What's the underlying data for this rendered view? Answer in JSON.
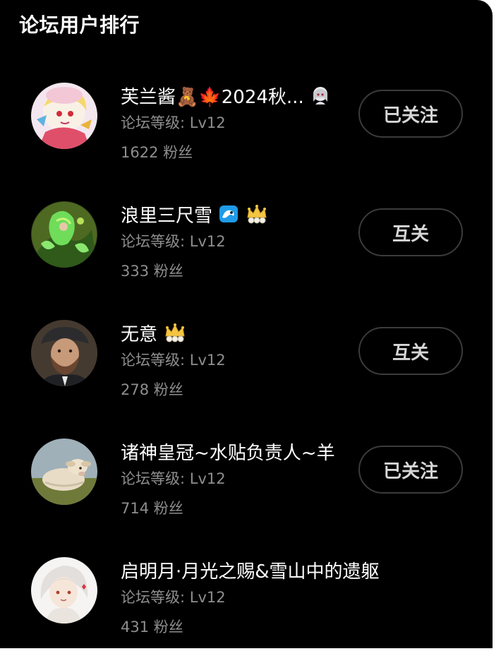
{
  "header": {
    "title": "论坛用户排行"
  },
  "users": [
    {
      "name": "芙兰酱🧸🍁2024秋...",
      "level_label": "论坛等级: Lv12",
      "fans_label": "1622 粉丝",
      "follow_label": "已关注",
      "badges": [
        "bear-emoji-icon",
        "maple-leaf-icon",
        "anime-girl-badge-icon"
      ]
    },
    {
      "name": "浪里三尺雪",
      "level_label": "论坛等级: Lv12",
      "fans_label": "333 粉丝",
      "follow_label": "互关",
      "badges": [
        "wave-badge-icon",
        "crown-icon"
      ]
    },
    {
      "name": "无意",
      "level_label": "论坛等级: Lv12",
      "fans_label": "278 粉丝",
      "follow_label": "互关",
      "badges": [
        "crown-icon"
      ]
    },
    {
      "name": "诸神皇冠~水贴负责人~羊",
      "level_label": "论坛等级: Lv12",
      "fans_label": "714 粉丝",
      "follow_label": "已关注",
      "badges": []
    },
    {
      "name": "启明月·月光之赐&雪山中的遗躯",
      "level_label": "论坛等级: Lv12",
      "fans_label": "431 粉丝",
      "badges": []
    }
  ],
  "colors": {
    "background": "#000000",
    "text_primary": "#ffffff",
    "text_secondary": "#8e8e8e",
    "button_border": "#3b3b3b",
    "button_text": "#d6d6d6"
  }
}
